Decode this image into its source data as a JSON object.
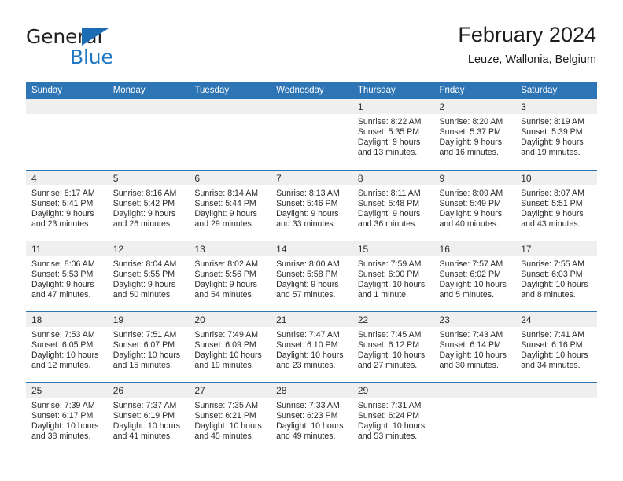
{
  "brand": {
    "name_top": "General",
    "name_bottom": "Blue",
    "triangle_icon": "triangle-icon",
    "accent_color": "#2079c4"
  },
  "header": {
    "title": "February 2024",
    "subtitle": "Leuze, Wallonia, Belgium"
  },
  "theme": {
    "header_blue": "#2e75b6",
    "daynum_gray": "#efefef",
    "text": "#2b2b2b"
  },
  "calendar": {
    "weekday_headers": [
      "Sunday",
      "Monday",
      "Tuesday",
      "Wednesday",
      "Thursday",
      "Friday",
      "Saturday"
    ],
    "weeks": [
      [
        {
          "day": "",
          "sunrise": "",
          "sunset": "",
          "daylight_line1": "",
          "daylight_line2": "",
          "empty": true
        },
        {
          "day": "",
          "sunrise": "",
          "sunset": "",
          "daylight_line1": "",
          "daylight_line2": "",
          "empty": true
        },
        {
          "day": "",
          "sunrise": "",
          "sunset": "",
          "daylight_line1": "",
          "daylight_line2": "",
          "empty": true
        },
        {
          "day": "",
          "sunrise": "",
          "sunset": "",
          "daylight_line1": "",
          "daylight_line2": "",
          "empty": true
        },
        {
          "day": "1",
          "sunrise": "Sunrise: 8:22 AM",
          "sunset": "Sunset: 5:35 PM",
          "daylight_line1": "Daylight: 9 hours",
          "daylight_line2": "and 13 minutes.",
          "empty": false
        },
        {
          "day": "2",
          "sunrise": "Sunrise: 8:20 AM",
          "sunset": "Sunset: 5:37 PM",
          "daylight_line1": "Daylight: 9 hours",
          "daylight_line2": "and 16 minutes.",
          "empty": false
        },
        {
          "day": "3",
          "sunrise": "Sunrise: 8:19 AM",
          "sunset": "Sunset: 5:39 PM",
          "daylight_line1": "Daylight: 9 hours",
          "daylight_line2": "and 19 minutes.",
          "empty": false
        }
      ],
      [
        {
          "day": "4",
          "sunrise": "Sunrise: 8:17 AM",
          "sunset": "Sunset: 5:41 PM",
          "daylight_line1": "Daylight: 9 hours",
          "daylight_line2": "and 23 minutes.",
          "empty": false
        },
        {
          "day": "5",
          "sunrise": "Sunrise: 8:16 AM",
          "sunset": "Sunset: 5:42 PM",
          "daylight_line1": "Daylight: 9 hours",
          "daylight_line2": "and 26 minutes.",
          "empty": false
        },
        {
          "day": "6",
          "sunrise": "Sunrise: 8:14 AM",
          "sunset": "Sunset: 5:44 PM",
          "daylight_line1": "Daylight: 9 hours",
          "daylight_line2": "and 29 minutes.",
          "empty": false
        },
        {
          "day": "7",
          "sunrise": "Sunrise: 8:13 AM",
          "sunset": "Sunset: 5:46 PM",
          "daylight_line1": "Daylight: 9 hours",
          "daylight_line2": "and 33 minutes.",
          "empty": false
        },
        {
          "day": "8",
          "sunrise": "Sunrise: 8:11 AM",
          "sunset": "Sunset: 5:48 PM",
          "daylight_line1": "Daylight: 9 hours",
          "daylight_line2": "and 36 minutes.",
          "empty": false
        },
        {
          "day": "9",
          "sunrise": "Sunrise: 8:09 AM",
          "sunset": "Sunset: 5:49 PM",
          "daylight_line1": "Daylight: 9 hours",
          "daylight_line2": "and 40 minutes.",
          "empty": false
        },
        {
          "day": "10",
          "sunrise": "Sunrise: 8:07 AM",
          "sunset": "Sunset: 5:51 PM",
          "daylight_line1": "Daylight: 9 hours",
          "daylight_line2": "and 43 minutes.",
          "empty": false
        }
      ],
      [
        {
          "day": "11",
          "sunrise": "Sunrise: 8:06 AM",
          "sunset": "Sunset: 5:53 PM",
          "daylight_line1": "Daylight: 9 hours",
          "daylight_line2": "and 47 minutes.",
          "empty": false
        },
        {
          "day": "12",
          "sunrise": "Sunrise: 8:04 AM",
          "sunset": "Sunset: 5:55 PM",
          "daylight_line1": "Daylight: 9 hours",
          "daylight_line2": "and 50 minutes.",
          "empty": false
        },
        {
          "day": "13",
          "sunrise": "Sunrise: 8:02 AM",
          "sunset": "Sunset: 5:56 PM",
          "daylight_line1": "Daylight: 9 hours",
          "daylight_line2": "and 54 minutes.",
          "empty": false
        },
        {
          "day": "14",
          "sunrise": "Sunrise: 8:00 AM",
          "sunset": "Sunset: 5:58 PM",
          "daylight_line1": "Daylight: 9 hours",
          "daylight_line2": "and 57 minutes.",
          "empty": false
        },
        {
          "day": "15",
          "sunrise": "Sunrise: 7:59 AM",
          "sunset": "Sunset: 6:00 PM",
          "daylight_line1": "Daylight: 10 hours",
          "daylight_line2": "and 1 minute.",
          "empty": false
        },
        {
          "day": "16",
          "sunrise": "Sunrise: 7:57 AM",
          "sunset": "Sunset: 6:02 PM",
          "daylight_line1": "Daylight: 10 hours",
          "daylight_line2": "and 5 minutes.",
          "empty": false
        },
        {
          "day": "17",
          "sunrise": "Sunrise: 7:55 AM",
          "sunset": "Sunset: 6:03 PM",
          "daylight_line1": "Daylight: 10 hours",
          "daylight_line2": "and 8 minutes.",
          "empty": false
        }
      ],
      [
        {
          "day": "18",
          "sunrise": "Sunrise: 7:53 AM",
          "sunset": "Sunset: 6:05 PM",
          "daylight_line1": "Daylight: 10 hours",
          "daylight_line2": "and 12 minutes.",
          "empty": false
        },
        {
          "day": "19",
          "sunrise": "Sunrise: 7:51 AM",
          "sunset": "Sunset: 6:07 PM",
          "daylight_line1": "Daylight: 10 hours",
          "daylight_line2": "and 15 minutes.",
          "empty": false
        },
        {
          "day": "20",
          "sunrise": "Sunrise: 7:49 AM",
          "sunset": "Sunset: 6:09 PM",
          "daylight_line1": "Daylight: 10 hours",
          "daylight_line2": "and 19 minutes.",
          "empty": false
        },
        {
          "day": "21",
          "sunrise": "Sunrise: 7:47 AM",
          "sunset": "Sunset: 6:10 PM",
          "daylight_line1": "Daylight: 10 hours",
          "daylight_line2": "and 23 minutes.",
          "empty": false
        },
        {
          "day": "22",
          "sunrise": "Sunrise: 7:45 AM",
          "sunset": "Sunset: 6:12 PM",
          "daylight_line1": "Daylight: 10 hours",
          "daylight_line2": "and 27 minutes.",
          "empty": false
        },
        {
          "day": "23",
          "sunrise": "Sunrise: 7:43 AM",
          "sunset": "Sunset: 6:14 PM",
          "daylight_line1": "Daylight: 10 hours",
          "daylight_line2": "and 30 minutes.",
          "empty": false
        },
        {
          "day": "24",
          "sunrise": "Sunrise: 7:41 AM",
          "sunset": "Sunset: 6:16 PM",
          "daylight_line1": "Daylight: 10 hours",
          "daylight_line2": "and 34 minutes.",
          "empty": false
        }
      ],
      [
        {
          "day": "25",
          "sunrise": "Sunrise: 7:39 AM",
          "sunset": "Sunset: 6:17 PM",
          "daylight_line1": "Daylight: 10 hours",
          "daylight_line2": "and 38 minutes.",
          "empty": false
        },
        {
          "day": "26",
          "sunrise": "Sunrise: 7:37 AM",
          "sunset": "Sunset: 6:19 PM",
          "daylight_line1": "Daylight: 10 hours",
          "daylight_line2": "and 41 minutes.",
          "empty": false
        },
        {
          "day": "27",
          "sunrise": "Sunrise: 7:35 AM",
          "sunset": "Sunset: 6:21 PM",
          "daylight_line1": "Daylight: 10 hours",
          "daylight_line2": "and 45 minutes.",
          "empty": false
        },
        {
          "day": "28",
          "sunrise": "Sunrise: 7:33 AM",
          "sunset": "Sunset: 6:23 PM",
          "daylight_line1": "Daylight: 10 hours",
          "daylight_line2": "and 49 minutes.",
          "empty": false
        },
        {
          "day": "29",
          "sunrise": "Sunrise: 7:31 AM",
          "sunset": "Sunset: 6:24 PM",
          "daylight_line1": "Daylight: 10 hours",
          "daylight_line2": "and 53 minutes.",
          "empty": false
        },
        {
          "day": "",
          "sunrise": "",
          "sunset": "",
          "daylight_line1": "",
          "daylight_line2": "",
          "empty": true
        },
        {
          "day": "",
          "sunrise": "",
          "sunset": "",
          "daylight_line1": "",
          "daylight_line2": "",
          "empty": true
        }
      ]
    ]
  }
}
